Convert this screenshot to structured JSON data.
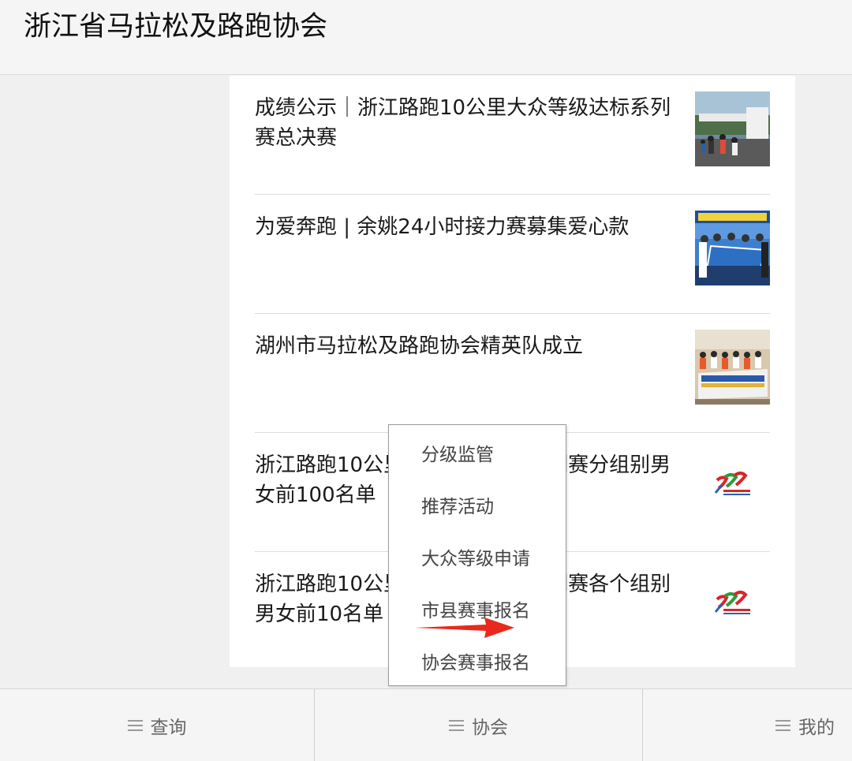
{
  "header": {
    "title": "浙江省马拉松及路跑协会"
  },
  "articles": [
    {
      "title": "成绩公示｜浙江路跑10公里大众等级达标系列赛总决赛",
      "thumb": "race-finish-photo"
    },
    {
      "title": "为爱奔跑 | 余姚24小时接力赛募集爱心款",
      "thumb": "group-banner-photo"
    },
    {
      "title": "湖州市马拉松及路跑协会精英队成立",
      "thumb": "team-photo"
    },
    {
      "title": "浙江路跑10公里大众等级达标系列赛分组别男女前100名单",
      "thumb": "logo"
    },
    {
      "title": "浙江路跑10公里大众等级达标系列赛各个组别男女前10名单",
      "thumb": "logo"
    }
  ],
  "popup_menu": {
    "items": [
      "分级监管",
      "推荐活动",
      "大众等级申请",
      "市县赛事报名",
      "协会赛事报名"
    ]
  },
  "tabbar": {
    "tabs": [
      {
        "label": "查询",
        "icon": "menu-icon"
      },
      {
        "label": "协会",
        "icon": "menu-icon"
      },
      {
        "label": "我的",
        "icon": "menu-icon"
      }
    ]
  },
  "colors": {
    "arrow": "#e8291c",
    "logo_red": "#d8262b",
    "logo_green": "#2f9a3b",
    "logo_blue": "#2a62b0"
  }
}
